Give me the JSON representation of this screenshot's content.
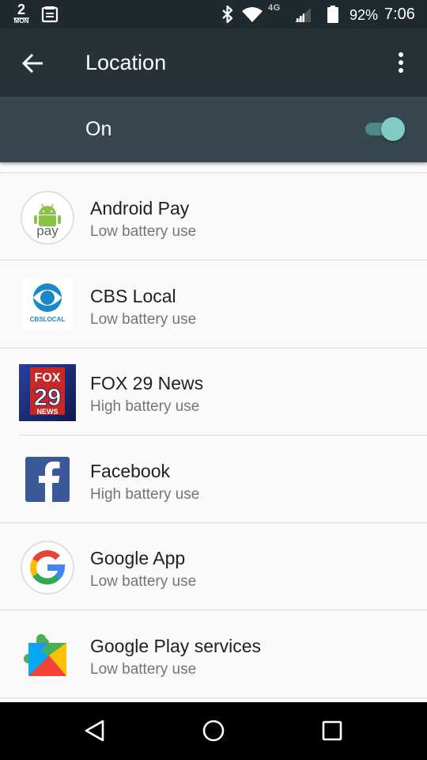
{
  "status_bar": {
    "calendar_day": "2",
    "calendar_dow": "MON",
    "network_label": "4G",
    "battery_percent": "92%",
    "time": "7:06",
    "icons": [
      "calendar-icon",
      "notes-icon",
      "bluetooth-icon",
      "wifi-icon",
      "signal-icon",
      "battery-icon"
    ]
  },
  "app_bar": {
    "title": "Location",
    "back_icon": "arrow-back-icon",
    "more_icon": "more-vert-icon"
  },
  "master_switch": {
    "label": "On",
    "checked": true
  },
  "apps": [
    {
      "name": "Android Pay",
      "usage": "Low battery use",
      "icon": "android-pay-icon",
      "icon_text": "pay"
    },
    {
      "name": "CBS Local",
      "usage": "Low battery use",
      "icon": "cbs-local-icon",
      "icon_text": "CBSLOCAL"
    },
    {
      "name": "FOX 29 News",
      "usage": "High battery use",
      "icon": "fox-29-news-icon",
      "icon_text_1": "FOX",
      "icon_text_2": "29",
      "icon_text_3": "NEWS"
    },
    {
      "name": "Facebook",
      "usage": "High battery use",
      "icon": "facebook-icon"
    },
    {
      "name": "Google App",
      "usage": "Low battery use",
      "icon": "google-app-icon"
    },
    {
      "name": "Google Play services",
      "usage": "Low battery use",
      "icon": "google-play-services-icon"
    }
  ],
  "nav_bar": {
    "icons": [
      "nav-back-icon",
      "nav-home-icon",
      "nav-recents-icon"
    ]
  },
  "colors": {
    "status_bar": "#1f2a30",
    "app_bar": "#263238",
    "switch_bar": "#37474f",
    "accent": "#80cbc4",
    "background": "#fafafa"
  }
}
